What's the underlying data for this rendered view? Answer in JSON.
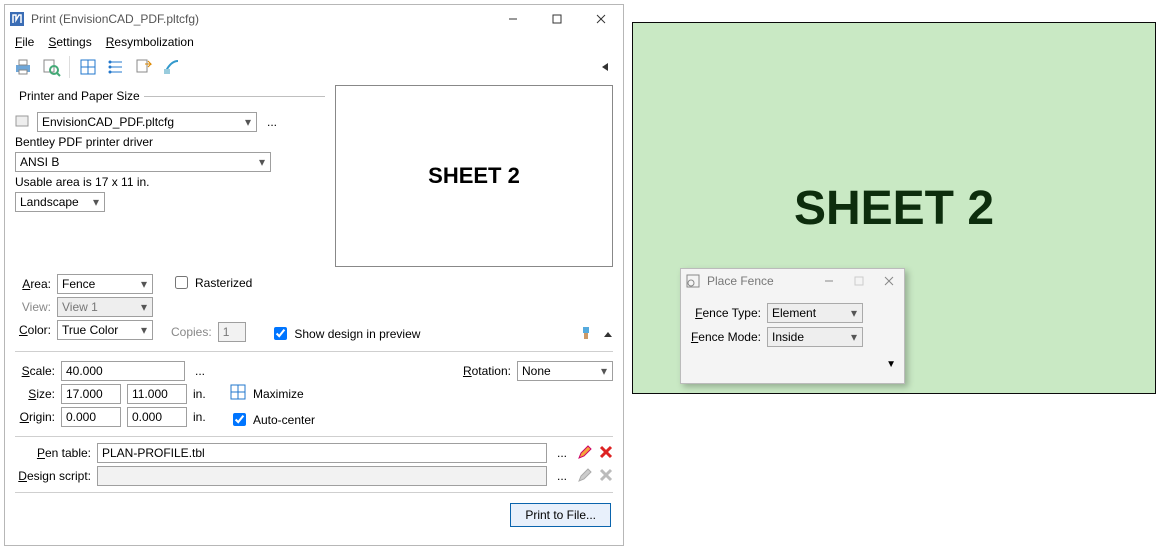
{
  "print": {
    "title": "Print  (EnvisionCAD_PDF.pltcfg)",
    "menu": {
      "file": "File",
      "settings": "Settings",
      "resym": "Resymbolization"
    },
    "printerSize": {
      "legend": "Printer and Paper Size",
      "configFile": "EnvisionCAD_PDF.pltcfg",
      "driverDesc": "Bentley PDF printer driver",
      "paperSize": "ANSI B",
      "usable": "Usable area is 17 x 11 in.",
      "orientation": "Landscape"
    },
    "area": {
      "areaLabel": "Area:",
      "area": "Fence",
      "viewLabel": "View:",
      "view": "View 1",
      "colorLabel": "Color:",
      "color": "True Color",
      "rasterized": "Rasterized",
      "copiesLabel": "Copies:",
      "copies": "1",
      "showDesign": "Show design in preview"
    },
    "scale": {
      "scaleLabel": "Scale:",
      "scale": "40.000",
      "sizeLabel": "Size:",
      "sizeX": "17.000",
      "sizeY": "11.000",
      "unit": "in.",
      "originLabel": "Origin:",
      "originX": "0.000",
      "originY": "0.000",
      "maximize": "Maximize",
      "autocenter": "Auto-center",
      "rotationLabel": "Rotation:",
      "rotation": "None"
    },
    "tables": {
      "penLabel": "Pen table:",
      "pen": "PLAN-PROFILE.tbl",
      "scriptLabel": "Design script:",
      "script": ""
    },
    "printBtn": "Print to File...",
    "preview": "SHEET 2"
  },
  "canvas": {
    "text": "SHEET 2"
  },
  "fence": {
    "title": "Place Fence",
    "typeLabel": "Fence Type:",
    "type": "Element",
    "modeLabel": "Fence Mode:",
    "mode": "Inside"
  }
}
